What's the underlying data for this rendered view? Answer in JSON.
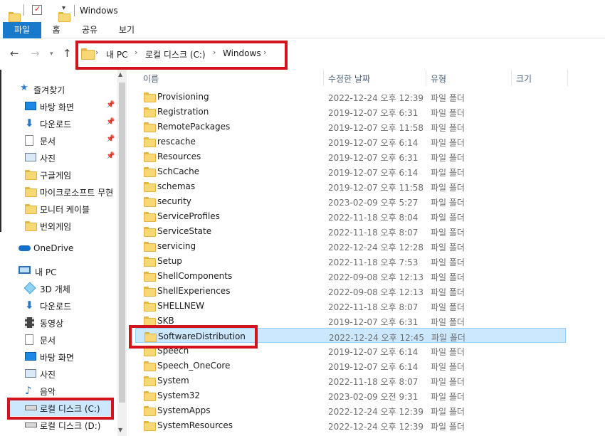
{
  "window": {
    "title": "Windows"
  },
  "ribbon": {
    "tabs": [
      "파일",
      "홈",
      "공유",
      "보기"
    ]
  },
  "address": {
    "crumbs": [
      "내 PC",
      "로컬 디스크 (C:)",
      "Windows"
    ]
  },
  "nav": {
    "quick_access_label": "즐겨찾기",
    "quick_items": [
      {
        "label": "바탕 화면",
        "icon": "desktop-icon",
        "pinned": true
      },
      {
        "label": "다운로드",
        "icon": "download-arrow-icon",
        "pinned": true
      },
      {
        "label": "문서",
        "icon": "document-icon",
        "pinned": true
      },
      {
        "label": "사진",
        "icon": "picture-icon",
        "pinned": true
      },
      {
        "label": "구글게임",
        "icon": "folder-icon",
        "pinned": false
      },
      {
        "label": "마이크로소프트 무현",
        "icon": "folder-icon",
        "pinned": false
      },
      {
        "label": "모니터 케이블",
        "icon": "folder-icon",
        "pinned": false
      },
      {
        "label": "번외게임",
        "icon": "folder-icon",
        "pinned": false
      }
    ],
    "onedrive_label": "OneDrive",
    "thispc_label": "내 PC",
    "pc_items": [
      {
        "label": "3D 개체",
        "icon": "3d-objects-icon"
      },
      {
        "label": "다운로드",
        "icon": "download-arrow-icon"
      },
      {
        "label": "동영상",
        "icon": "video-icon"
      },
      {
        "label": "문서",
        "icon": "document-icon"
      },
      {
        "label": "바탕 화면",
        "icon": "desktop-icon"
      },
      {
        "label": "사진",
        "icon": "picture-icon"
      },
      {
        "label": "음악",
        "icon": "music-icon"
      },
      {
        "label": "로컬 디스크 (C:)",
        "icon": "drive-icon",
        "selected": true
      },
      {
        "label": "로컬 디스크 (D:)",
        "icon": "drive-icon"
      }
    ]
  },
  "columns": {
    "name": "이름",
    "modified": "수정한 날짜",
    "type": "유형",
    "size": "크기"
  },
  "files": [
    {
      "name": "Provisioning",
      "modified": "2022-12-24 오후 12:39",
      "type": "파일 폴더"
    },
    {
      "name": "Registration",
      "modified": "2019-12-07 오후 6:31",
      "type": "파일 폴더"
    },
    {
      "name": "RemotePackages",
      "modified": "2019-12-07 오후 11:58",
      "type": "파일 폴더"
    },
    {
      "name": "rescache",
      "modified": "2019-12-07 오후 6:14",
      "type": "파일 폴더"
    },
    {
      "name": "Resources",
      "modified": "2019-12-07 오후 6:31",
      "type": "파일 폴더"
    },
    {
      "name": "SchCache",
      "modified": "2019-12-07 오후 6:14",
      "type": "파일 폴더"
    },
    {
      "name": "schemas",
      "modified": "2019-12-07 오후 11:58",
      "type": "파일 폴더"
    },
    {
      "name": "security",
      "modified": "2023-02-09 오후 5:27",
      "type": "파일 폴더"
    },
    {
      "name": "ServiceProfiles",
      "modified": "2022-11-18 오후 8:04",
      "type": "파일 폴더"
    },
    {
      "name": "ServiceState",
      "modified": "2022-11-18 오후 8:07",
      "type": "파일 폴더"
    },
    {
      "name": "servicing",
      "modified": "2022-12-24 오후 12:28",
      "type": "파일 폴더"
    },
    {
      "name": "Setup",
      "modified": "2022-11-18 오후 7:53",
      "type": "파일 폴더"
    },
    {
      "name": "ShellComponents",
      "modified": "2022-09-08 오후 12:13",
      "type": "파일 폴더"
    },
    {
      "name": "ShellExperiences",
      "modified": "2022-09-08 오후 12:13",
      "type": "파일 폴더"
    },
    {
      "name": "SHELLNEW",
      "modified": "2022-11-18 오후 8:07",
      "type": "파일 폴더"
    },
    {
      "name": "SKB",
      "modified": "2019-12-07 오후 6:31",
      "type": "파일 폴더"
    },
    {
      "name": "SoftwareDistribution",
      "modified": "2022-12-24 오후 12:45",
      "type": "파일 폴더",
      "selected": true
    },
    {
      "name": "Speech",
      "modified": "2019-12-07 오후 6:14",
      "type": "파일 폴더"
    },
    {
      "name": "Speech_OneCore",
      "modified": "2019-12-07 오후 6:14",
      "type": "파일 폴더"
    },
    {
      "name": "System",
      "modified": "2022-11-18 오후 8:07",
      "type": "파일 폴더"
    },
    {
      "name": "System32",
      "modified": "2023-02-09 오전 9:31",
      "type": "파일 폴더"
    },
    {
      "name": "SystemApps",
      "modified": "2022-12-24 오후 12:39",
      "type": "파일 폴더"
    },
    {
      "name": "SystemResources",
      "modified": "2022-12-24 오후 12:39",
      "type": "파일 폴더"
    }
  ],
  "colors": {
    "accent": "#1979ca",
    "selection": "#cce8ff",
    "highlight": "#d3131b",
    "folder": "#f8d775"
  }
}
